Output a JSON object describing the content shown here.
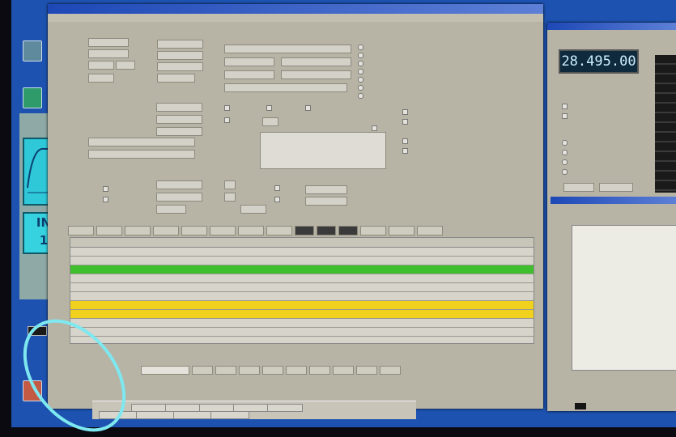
{
  "desktop": {
    "icons": [
      {
        "name": "app-icon-1"
      },
      {
        "name": "app-icon-2"
      },
      {
        "name": "app-icon-3"
      }
    ]
  },
  "left_panel": {
    "tile_text_1": "IN",
    "tile_text_2": "1"
  },
  "main_window": {
    "columns": [
      "",
      "",
      "",
      "",
      "",
      "",
      "",
      "",
      "",
      "",
      "",
      "",
      "",
      "",
      "",
      "",
      ""
    ],
    "rows": [
      {
        "highlight": "none"
      },
      {
        "highlight": "none"
      },
      {
        "highlight": "green"
      },
      {
        "highlight": "none"
      },
      {
        "highlight": "none"
      },
      {
        "highlight": "none"
      },
      {
        "highlight": "yellow"
      },
      {
        "highlight": "yellow"
      },
      {
        "highlight": "none"
      },
      {
        "highlight": "none"
      },
      {
        "highlight": "none"
      },
      {
        "highlight": "none"
      }
    ]
  },
  "right_window": {
    "frequency_display": "28.495.00"
  },
  "colors": {
    "desktop_blue": "#1d52b0",
    "row_green": "#3fbf2e",
    "row_yellow": "#f0d21e",
    "freq_display_bg": "#0e2a3c",
    "annotation_circle": "#7ee8f0"
  }
}
